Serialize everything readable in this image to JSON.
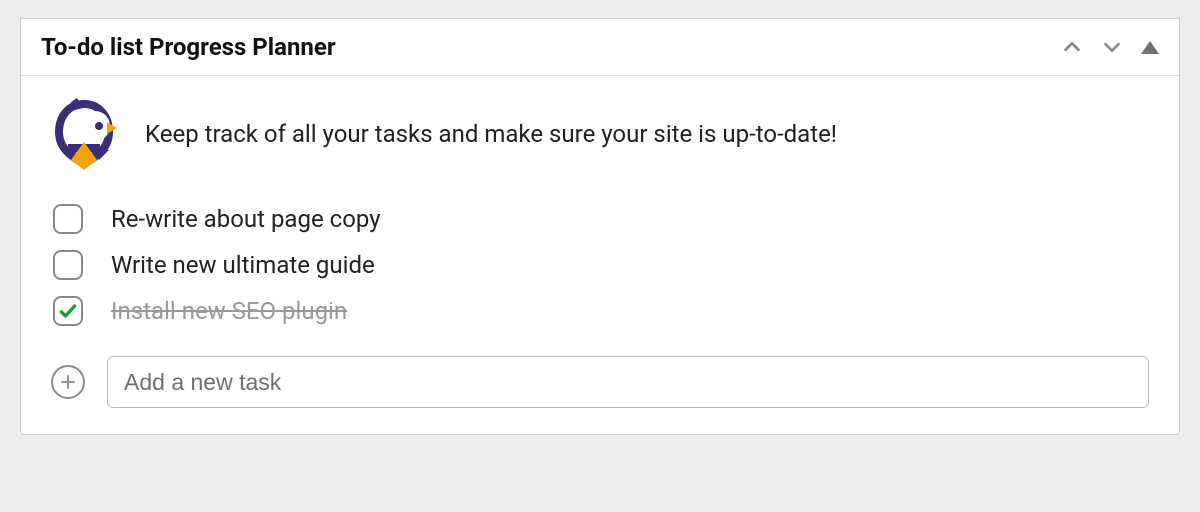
{
  "panel": {
    "title": "To-do list Progress Planner",
    "intro": "Keep track of all your tasks and make sure your site is up-to-date!"
  },
  "tasks": [
    {
      "label": "Re-write about page copy",
      "done": false
    },
    {
      "label": "Write new ultimate guide",
      "done": false
    },
    {
      "label": "Install new SEO plugin",
      "done": true
    }
  ],
  "add": {
    "placeholder": "Add a new task"
  }
}
